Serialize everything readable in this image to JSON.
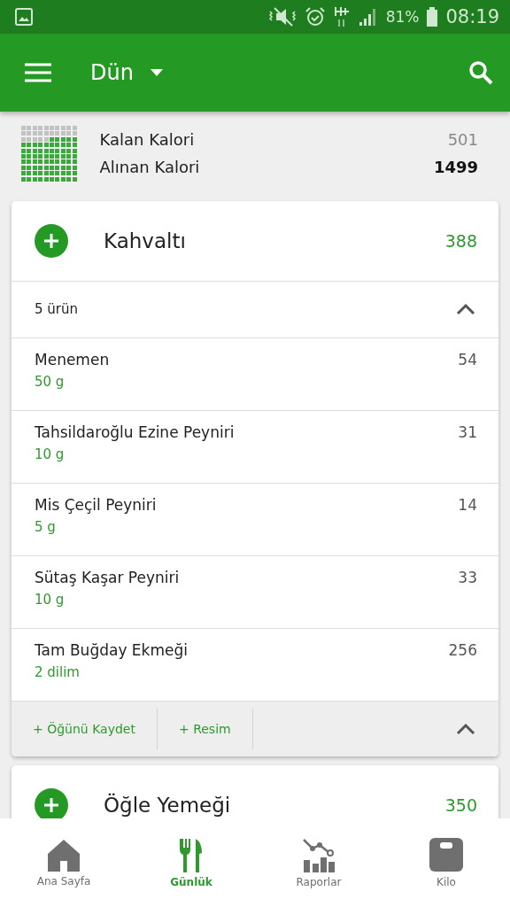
{
  "status_bar": {
    "battery": "81%",
    "time": "08:19"
  },
  "app_bar": {
    "title": "Dün"
  },
  "summary": {
    "rows": [
      {
        "label": "Kalan Kalori",
        "value": "501",
        "kind": "remaining"
      },
      {
        "label": "Alınan Kalori",
        "value": "1499",
        "kind": "consumed"
      }
    ]
  },
  "meals": [
    {
      "title": "Kahvaltı",
      "calories": "388",
      "count": "5 ürün",
      "expanded": true,
      "items": [
        {
          "name": "Menemen",
          "amount": "50 g",
          "calories": "54"
        },
        {
          "name": "Tahsildaroğlu Ezine Peyniri",
          "amount": "10 g",
          "calories": "31"
        },
        {
          "name": "Mis Çeçil Peyniri",
          "amount": "5 g",
          "calories": "14"
        },
        {
          "name": "Sütaş Kaşar Peyniri",
          "amount": "10 g",
          "calories": "33"
        },
        {
          "name": "Tam Buğday Ekmeği",
          "amount": "2  dilim",
          "calories": "256"
        }
      ],
      "actions": [
        "+ Öğünü Kaydet",
        "+ Resim"
      ]
    },
    {
      "title": "Öğle Yemeği",
      "calories": "350"
    }
  ],
  "nav": [
    {
      "label": "Ana Sayfa",
      "kind": "home",
      "selected": false
    },
    {
      "label": "Günlük",
      "kind": "diary",
      "selected": true
    },
    {
      "label": "Raporlar",
      "kind": "reports",
      "selected": false
    },
    {
      "label": "Kilo",
      "kind": "scale",
      "selected": false
    }
  ]
}
